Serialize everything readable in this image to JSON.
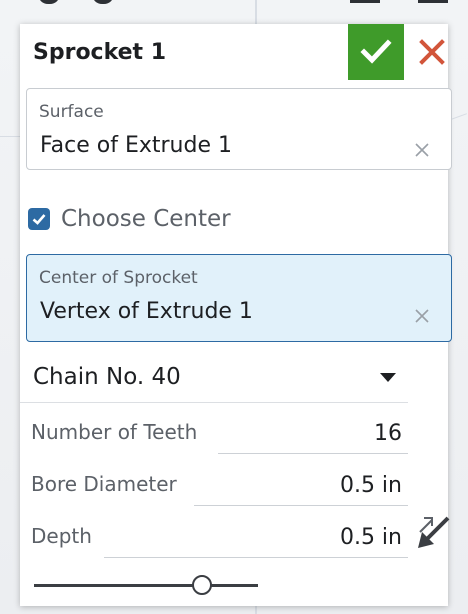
{
  "dialog": {
    "title": "Sprocket 1"
  },
  "surface": {
    "label": "Surface",
    "value": "Face of Extrude 1"
  },
  "choose_center": {
    "label": "Choose Center",
    "checked": true
  },
  "center": {
    "label": "Center of Sprocket",
    "value": "Vertex of Extrude 1"
  },
  "chain": {
    "selected": "Chain No. 40"
  },
  "params": {
    "teeth": {
      "label": "Number of Teeth",
      "value": "16"
    },
    "bore": {
      "label": "Bore Diameter",
      "value": "0.5 in"
    },
    "depth": {
      "label": "Depth",
      "value": "0.5 in"
    }
  },
  "slider": {
    "value_fraction": 0.75
  },
  "colors": {
    "accept": "#3f9b2a",
    "cancel": "#d2553a",
    "active_field": "#e1f1fa",
    "active_border": "#2d6aa3",
    "checkbox": "#2d6aa3"
  },
  "icons": {
    "accept": "check-icon",
    "cancel": "close-icon",
    "clear": "clear-icon",
    "dropdown": "chevron-down-icon",
    "flip": "flip-direction-icon"
  }
}
